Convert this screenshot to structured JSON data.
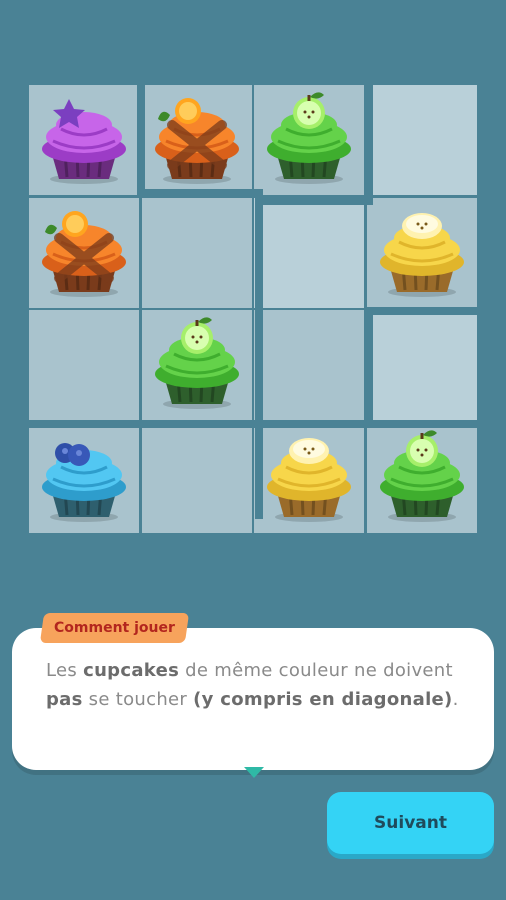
{
  "board": {
    "size": 4,
    "grid_rows": [
      [
        "purple-cupcake",
        "orange-cupcake-crossed",
        "green-cupcake",
        "empty"
      ],
      [
        "orange-cupcake-crossed",
        "empty",
        "empty",
        "yellow-cupcake"
      ],
      [
        "empty",
        "green-cupcake",
        "empty",
        "empty"
      ],
      [
        "blue-cupcake",
        "empty",
        "yellow-cupcake",
        "green-cupcake"
      ]
    ],
    "colors": {
      "cell_light": "#b9d0d9",
      "cell_mid": "#a9c3cd",
      "cell_dark": "#9fbcc7",
      "wall": "#4a8295"
    }
  },
  "tip": {
    "tag": "Comment jouer",
    "text_parts": [
      {
        "t": "Les ",
        "b": false
      },
      {
        "t": "cupcakes",
        "b": true
      },
      {
        "t": " de même couleur ne doivent ",
        "b": false
      },
      {
        "t": "pas",
        "b": true
      },
      {
        "t": " se toucher ",
        "b": false
      },
      {
        "t": "(y compris en diagonale)",
        "b": true
      },
      {
        "t": ".",
        "b": false
      }
    ]
  },
  "buttons": {
    "next": "Suivant"
  },
  "icons": {
    "purple-cupcake": "star-topped purple cupcake",
    "orange-cupcake-crossed": "orange cupcake with X",
    "green-cupcake": "apple-topped green cupcake",
    "yellow-cupcake": "banana-topped yellow cupcake",
    "blue-cupcake": "blueberry-topped blue cupcake"
  }
}
